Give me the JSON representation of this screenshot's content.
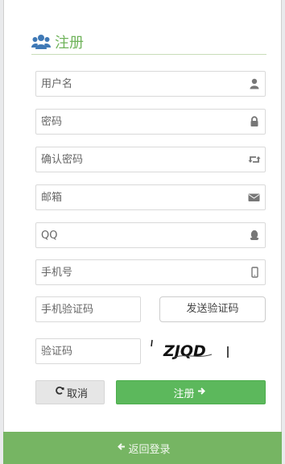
{
  "header": {
    "title": "注册",
    "icon": "users-icon"
  },
  "fields": {
    "username": {
      "placeholder": "用户名",
      "icon": "user-icon"
    },
    "password": {
      "placeholder": "密码",
      "icon": "lock-icon"
    },
    "confirm_password": {
      "placeholder": "确认密码",
      "icon": "retweet-icon"
    },
    "email": {
      "placeholder": "邮箱",
      "icon": "envelope-icon"
    },
    "qq": {
      "placeholder": "QQ",
      "icon": "qq-icon"
    },
    "phone": {
      "placeholder": "手机号",
      "icon": "mobile-icon"
    },
    "sms_code": {
      "placeholder": "手机验证码"
    },
    "captcha": {
      "placeholder": "验证码"
    }
  },
  "buttons": {
    "send_code": "发送验证码",
    "cancel": "取消",
    "submit": "注册"
  },
  "captcha_image": {
    "text": "ZJQD"
  },
  "footer": {
    "back_label": "返回登录"
  },
  "colors": {
    "accent_green": "#5cb85c",
    "title_green": "#6fb35a",
    "footer_green": "#76b563"
  }
}
